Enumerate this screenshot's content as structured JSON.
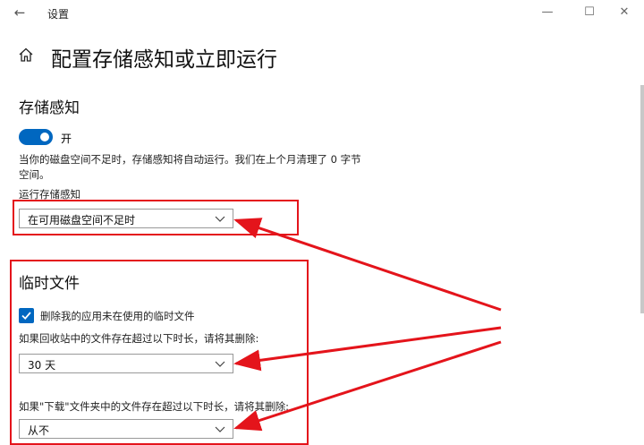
{
  "window": {
    "title": "设置",
    "back_glyph": "←",
    "minimize_glyph": "—",
    "maximize_glyph": "☐",
    "close_glyph": "✕"
  },
  "page": {
    "title": "配置存储感知或立即运行"
  },
  "storage_sense": {
    "section_title": "存储感知",
    "toggle_state": "开",
    "description": "当你的磁盘空间不足时，存储感知将自动运行。我们在上个月清理了 0 字节 空间。",
    "run_label": "运行存储感知",
    "run_value": "在可用磁盘空间不足时"
  },
  "temp_files": {
    "section_title": "临时文件",
    "delete_unused_label": "删除我的应用未在使用的临时文件",
    "delete_unused_checked": true,
    "recycle_label": "如果回收站中的文件存在超过以下时长，请将其删除:",
    "recycle_value": "30 天",
    "downloads_label": "如果\"下载\"文件夹中的文件存在超过以下时长，请将其删除:",
    "downloads_value": "从不"
  },
  "colors": {
    "accent": "#0067c0",
    "annotation": "#e4141b"
  },
  "icons": [
    "back-arrow-icon",
    "home-icon",
    "chevron-down-icon",
    "checkmark-icon"
  ]
}
